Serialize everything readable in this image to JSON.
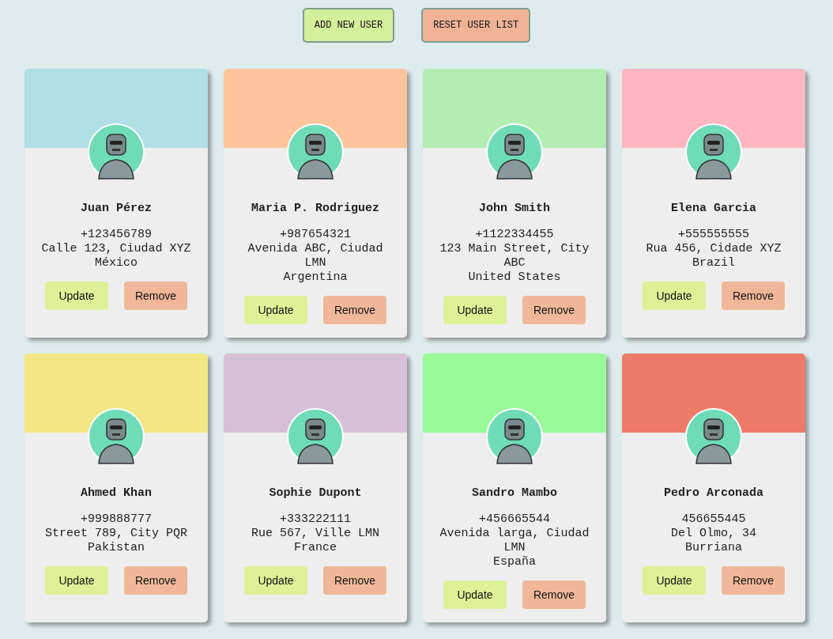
{
  "actions": [
    {
      "label": "ADD NEW USER",
      "kind": "add"
    },
    {
      "label": "RESET USER LIST",
      "kind": "reset"
    }
  ],
  "users": [
    {
      "name": "Juan Pérez",
      "phone": "+123456789",
      "address": "Calle 123, Ciudad XYZ",
      "country": "México",
      "color": "#b0dfe5",
      "update": "Update",
      "remove": "Remove"
    },
    {
      "name": "Maria P. Rodriguez",
      "phone": "+987654321",
      "address": "Avenida ABC, Ciudad LMN",
      "country": "Argentina",
      "color": "#ffc49b",
      "update": "Update",
      "remove": "Remove"
    },
    {
      "name": "John Smith",
      "phone": "+1122334455",
      "address": "123 Main Street, City ABC",
      "country": "United States",
      "color": "#b2edb2",
      "update": "Update",
      "remove": "Remove"
    },
    {
      "name": "Elena Garcia",
      "phone": "+555555555",
      "address": "Rua 456, Cidade XYZ",
      "country": "Brazil",
      "color": "#ffb6c1",
      "update": "Update",
      "remove": "Remove"
    },
    {
      "name": "Ahmed Khan",
      "phone": "+999888777",
      "address": "Street 789, City PQR",
      "country": "Pakistan",
      "color": "#f3e785",
      "update": "Update",
      "remove": "Remove"
    },
    {
      "name": "Sophie Dupont",
      "phone": "+333222111",
      "address": "Rue 567, Ville LMN",
      "country": "France",
      "color": "#d8bfd8",
      "update": "Update",
      "remove": "Remove"
    },
    {
      "name": "Sandro Mambo",
      "phone": "+456665544",
      "address": "Avenida larga, Ciudad LMN",
      "country": "España",
      "color": "#98fb98",
      "update": "Update",
      "remove": "Remove"
    },
    {
      "name": "Pedro Arconada",
      "phone": "456655445",
      "address": "Del Olmo, 34",
      "country": "Burriana",
      "color": "#ee7b68",
      "update": "Update",
      "remove": "Remove"
    }
  ]
}
